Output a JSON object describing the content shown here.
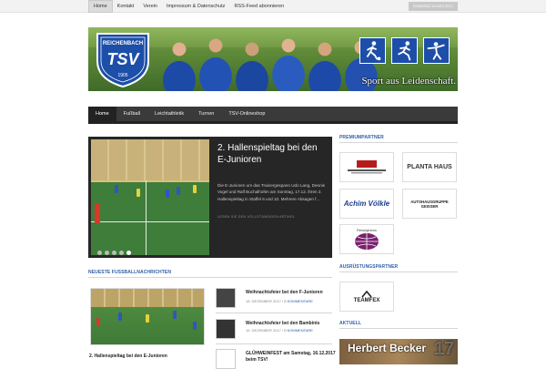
{
  "topnav": {
    "items": [
      "Home",
      "Kontakt",
      "Verein",
      "Impressum & Datenschutz",
      "RSS-Feed abonnieren"
    ],
    "date": "SONNTAG 24 DEZ 2017"
  },
  "header": {
    "logo_name": "REICHENBACH",
    "logo_letters": "TSV",
    "logo_year": "1905",
    "slogan": "Sport aus Leidenschaft."
  },
  "mainnav": {
    "items": [
      "Home",
      "Fußball",
      "Leichtathletik",
      "Turnen",
      "TSV-Onlineshop"
    ]
  },
  "slider": {
    "title": "2. Hallenspieltag bei den E-Junioren",
    "excerpt": "Die E-Junioren um das Trainergespann Udo Lang, Dennis Vogel und Ralf Buchalhofen am Sonntag, 17.12. ihren 2. Hallenspieltag in Staffel 6 und 10. Mehrere Absagen f…",
    "more": "LESEN SIE DEN VOLLSTÄNDIGEN ARTIKEL",
    "dots": 5,
    "active_dot": 4
  },
  "fussball": {
    "section_title": "NEUESTE FUSSBALLNACHRICHTEN",
    "featured_title": "2. Hallenspieltag bei den E-Junioren",
    "items": [
      {
        "title": "Weihnachtsfeier bei den F-Junioren",
        "date": "18. DEZEMBER 2017",
        "comments": "0 KOMMENTARE"
      },
      {
        "title": "Weihnachtsfeier bei den Bambinis",
        "date": "16. DEZEMBER 2017",
        "comments": "0 KOMMENTARE"
      },
      {
        "title": "GLÜHWEINFEST am Samstag, 16.12.2017 beim TSV!",
        "date": "",
        "comments": ""
      }
    ]
  },
  "sidebar": {
    "premium_title": "PREMIUMPARTNER",
    "sponsors": [
      "",
      "PLANTA HAUS",
      "Achim Völkle",
      "AUTOHAUSGRUPPE GEISSER",
      "Reiseglobus",
      ""
    ],
    "ausruestung_title": "AUSRÜSTUNGSPARTNER",
    "ausruestung": "TEAMFEX",
    "aktuell_title": "AKTUELL",
    "aktuell_name": "Herbert Becker",
    "aktuell_num": "17"
  },
  "colors": {
    "accent": "#2d5fa8",
    "nav_bg": "#3a3a3a",
    "slider_bg": "#262626"
  }
}
